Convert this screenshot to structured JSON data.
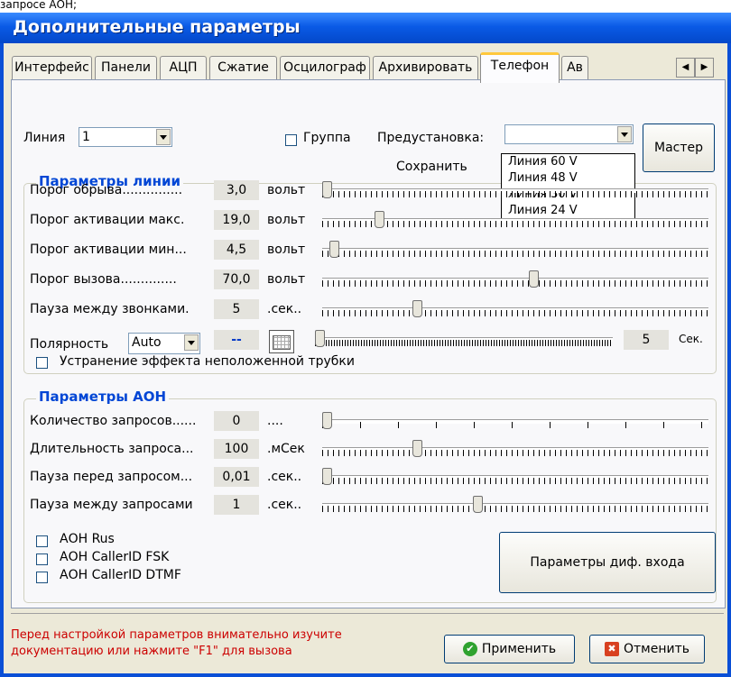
{
  "top_text": "запросе АОН;",
  "window": {
    "title": "Дополнительные параметры"
  },
  "tabs": [
    "Интерфейс",
    "Панели",
    "АЦП",
    "Сжатие",
    "Осцилограф",
    "Архивировать",
    "Телефон",
    "Ав"
  ],
  "active_tab": "Телефон",
  "line": {
    "label": "Линия",
    "value": "1"
  },
  "group_checkbox_label": "Группа",
  "preset": {
    "label": "Предустановка:",
    "value": "",
    "save_label": "Сохранить",
    "options": [
      "Линия  60 V",
      "Линия  48 V",
      "Линия  30 V",
      "Линия  24 V"
    ]
  },
  "master_button": "Мастер",
  "line_params": {
    "title": "Параметры линии",
    "rows": [
      {
        "label": "Порог обрыва...............",
        "value": "3,0",
        "unit": "вольт",
        "slider_fraction": 0.0
      },
      {
        "label": "Порог активации макс.",
        "value": "19,0",
        "unit": "вольт",
        "slider_fraction": 0.14
      },
      {
        "label": "Порог активации мин...",
        "value": "4,5",
        "unit": "вольт",
        "slider_fraction": 0.02
      },
      {
        "label": "Порог вызова..............",
        "value": "70,0",
        "unit": "вольт",
        "slider_fraction": 0.55
      },
      {
        "label": "Пауза между звонками.",
        "value": "5",
        "unit": ".сек..",
        "slider_fraction": 0.24
      }
    ],
    "polarity": {
      "label": "Полярность",
      "value": "Auto",
      "dash": "--",
      "seconds_value": "5",
      "seconds_unit": "Сек.",
      "slider_fraction": 0.0
    },
    "offhook_label": "Устранение эффекта неположенной трубки"
  },
  "aon_params": {
    "title": "Параметры АОН",
    "rows": [
      {
        "label": "Количество запросов......",
        "value": "0",
        "unit": "....",
        "slider_fraction": 0.0
      },
      {
        "label": "Длительность запроса...",
        "value": "100",
        "unit": ".мСек",
        "slider_fraction": 0.24
      },
      {
        "label": "Пауза перед запросом...",
        "value": "0,01",
        "unit": ".сек..",
        "slider_fraction": 0.0
      },
      {
        "label": "Пауза между запросами",
        "value": "1",
        "unit": ".сек..",
        "slider_fraction": 0.4
      }
    ],
    "checkboxes": [
      "АОН Rus",
      "АОН CallerID FSK",
      "АОН CallerID DTMF"
    ],
    "diff_button": "Параметры диф. входа"
  },
  "footer": {
    "note_line1": "Перед настройкой параметров внимательно изучите",
    "note_line2": "документацию или нажмите \"F1\" для вызова",
    "note_color": "#cc0000",
    "apply": "Применить",
    "cancel": "Отменить"
  }
}
